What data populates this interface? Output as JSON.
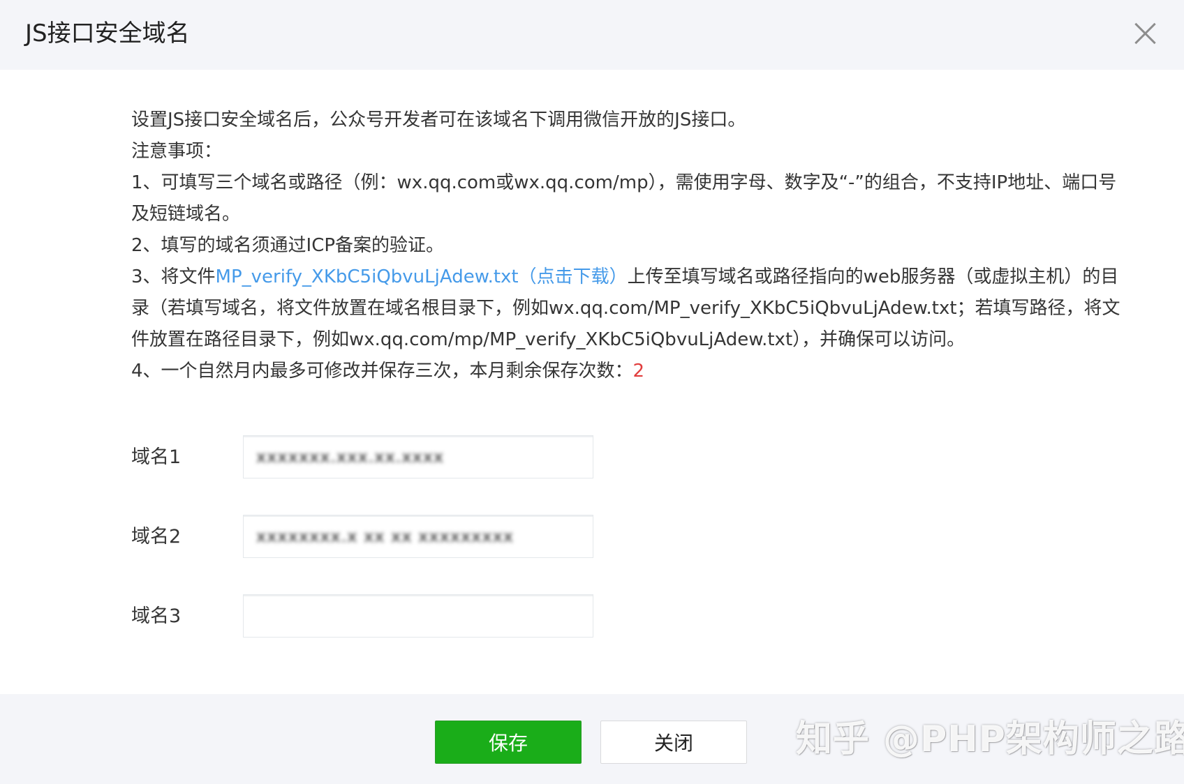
{
  "header": {
    "title": "JS接口安全域名"
  },
  "content": {
    "intro": "设置JS接口安全域名后，公众号开发者可在该域名下调用微信开放的JS接口。",
    "notice_title": "注意事项：",
    "item1": "1、可填写三个域名或路径（例：wx.qq.com或wx.qq.com/mp），需使用字母、数字及“-”的组合，不支持IP地址、端口号及短链域名。",
    "item2": "2、填写的域名须通过ICP备案的验证。",
    "item3_prefix": "3、将文件",
    "item3_link": "MP_verify_XKbC5iQbvuLjAdew.txt（点击下载）",
    "item3_suffix": "上传至填写域名或路径指向的web服务器（或虚拟主机）的目录（若填写域名，将文件放置在域名根目录下，例如wx.qq.com/MP_verify_XKbC5iQbvuLjAdew.txt；若填写路径，将文件放置在路径目录下，例如wx.qq.com/mp/MP_verify_XKbC5iQbvuLjAdew.txt），并确保可以访问。",
    "item4_prefix": "4、一个自然月内最多可修改并保存三次，本月剩余保存次数：",
    "item4_count": "2"
  },
  "form": {
    "fields": [
      {
        "label": "域名1",
        "value": "xxxxxxx.xxx.xx.xxxx",
        "blurred": true
      },
      {
        "label": "域名2",
        "value": "xxxxxxxx.x xx xx xxxxxxxxx",
        "blurred": true
      },
      {
        "label": "域名3",
        "value": "",
        "blurred": false
      }
    ]
  },
  "footer": {
    "save_label": "保存",
    "close_label": "关闭",
    "watermark": "知乎 @PHP架构师之路"
  },
  "colors": {
    "header_bg": "#f4f5f9",
    "link": "#459ae9",
    "count": "#e13c3c",
    "save_button": "#1aad19"
  }
}
